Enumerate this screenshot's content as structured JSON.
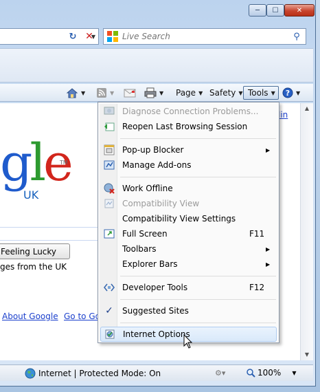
{
  "window": {
    "minimize_glyph": "─",
    "maximize_glyph": "☐",
    "close_glyph": "✕"
  },
  "address_bar": {
    "dropdown_icon": "chevron-down-icon",
    "refresh_icon": "refresh-icon",
    "stop_icon": "stop-icon"
  },
  "search": {
    "placeholder": "Live Search",
    "provider_icon": "windows-live-icon",
    "go_icon": "search-icon"
  },
  "command_bar": {
    "home_icon": "home-icon",
    "feeds_icon": "rss-icon",
    "mail_icon": "mail-icon",
    "print_icon": "printer-icon",
    "page_label": "Page",
    "safety_label": "Safety",
    "tools_label": "Tools",
    "help_icon": "help-icon"
  },
  "page": {
    "logo_text_g": "g",
    "logo_text_l": "l",
    "logo_text_e": "e",
    "tm": "TM",
    "uk_label": "UK",
    "lucky_button": "Feeling Lucky",
    "pages_uk": "ges from the UK",
    "about_link": "About Google",
    "goto_link": "Go to Go",
    "lang_link": "lin"
  },
  "tools_menu": {
    "items": [
      {
        "label": "Diagnose Connection Problems...",
        "disabled": true,
        "icon": "diagnose-icon"
      },
      {
        "label": "Reopen Last Browsing Session",
        "disabled": false,
        "icon": "reopen-session-icon"
      },
      {
        "label": "Pop-up Blocker",
        "disabled": false,
        "icon": "popup-blocker-icon",
        "submenu": true
      },
      {
        "label": "Manage Add-ons",
        "disabled": false,
        "icon": "addons-icon"
      },
      {
        "label": "Work Offline",
        "disabled": false,
        "icon": "work-offline-icon"
      },
      {
        "label": "Compatibility View",
        "disabled": true,
        "icon": "compatibility-view-icon"
      },
      {
        "label": "Compatibility View Settings",
        "disabled": false,
        "icon": ""
      },
      {
        "label": "Full Screen",
        "disabled": false,
        "icon": "fullscreen-icon",
        "shortcut": "F11"
      },
      {
        "label": "Toolbars",
        "disabled": false,
        "icon": "",
        "submenu": true
      },
      {
        "label": "Explorer Bars",
        "disabled": false,
        "icon": "",
        "submenu": true
      },
      {
        "label": "Developer Tools",
        "disabled": false,
        "icon": "developer-tools-icon",
        "shortcut": "F12"
      },
      {
        "label": "Suggested Sites",
        "disabled": false,
        "icon": "checkmark-icon",
        "checked": true
      },
      {
        "label": "Internet Options",
        "disabled": false,
        "icon": "internet-options-icon",
        "highlighted": true
      }
    ]
  },
  "status_bar": {
    "zone_text": "Internet | Protected Mode: On",
    "zoom_text": "100%"
  },
  "colors": {
    "accent": "#1a3fcc",
    "menu_highlight": "#d9e9fa",
    "google_blue": "#1f5bcc",
    "google_red": "#d2261c",
    "google_green": "#2d9a2f"
  }
}
